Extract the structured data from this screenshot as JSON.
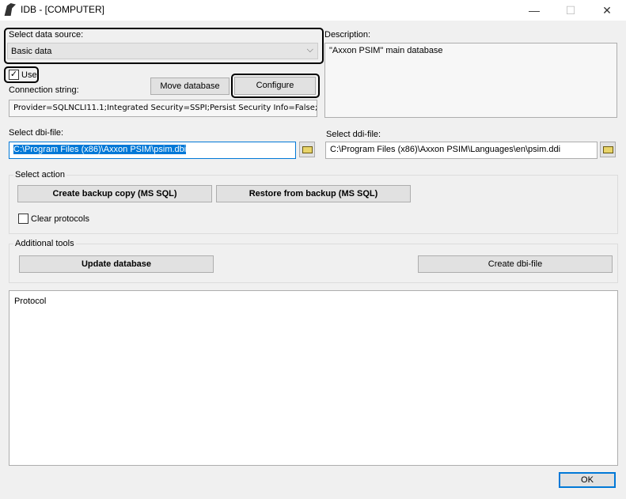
{
  "window": {
    "title": "IDB - [COMPUTER]",
    "minimize": "—",
    "maximize": "☐",
    "close": "✕"
  },
  "data_source": {
    "label": "Select data source:",
    "value": "Basic data",
    "chevron": "⌵"
  },
  "use": {
    "label": "Use",
    "checked": true,
    "check": "✓"
  },
  "connection": {
    "label": "Connection string:",
    "value": "Provider=SQLNCLI11.1;Integrated Security=SSPI;Persist Security Info=False;I"
  },
  "buttons": {
    "move": "Move database",
    "configure": "Configure",
    "backup": "Create backup copy (MS SQL)",
    "restore": "Restore from backup (MS SQL)",
    "update": "Update database",
    "create_dbi": "Create dbi-file",
    "ok": "OK"
  },
  "description": {
    "label": "Description:",
    "value": "\"Axxon PSIM\" main database"
  },
  "dbi": {
    "label": "Select dbi-file:",
    "value": "C:\\Program Files (x86)\\Axxon PSIM\\psim.dbi"
  },
  "ddi": {
    "label": "Select ddi-file:",
    "value": "C:\\Program Files (x86)\\Axxon PSIM\\Languages\\en\\psim.ddi"
  },
  "select_action": {
    "label": "Select action",
    "clear_protocols": "Clear protocols"
  },
  "additional_tools": {
    "label": "Additional tools"
  },
  "protocol": {
    "label": "Protocol"
  }
}
